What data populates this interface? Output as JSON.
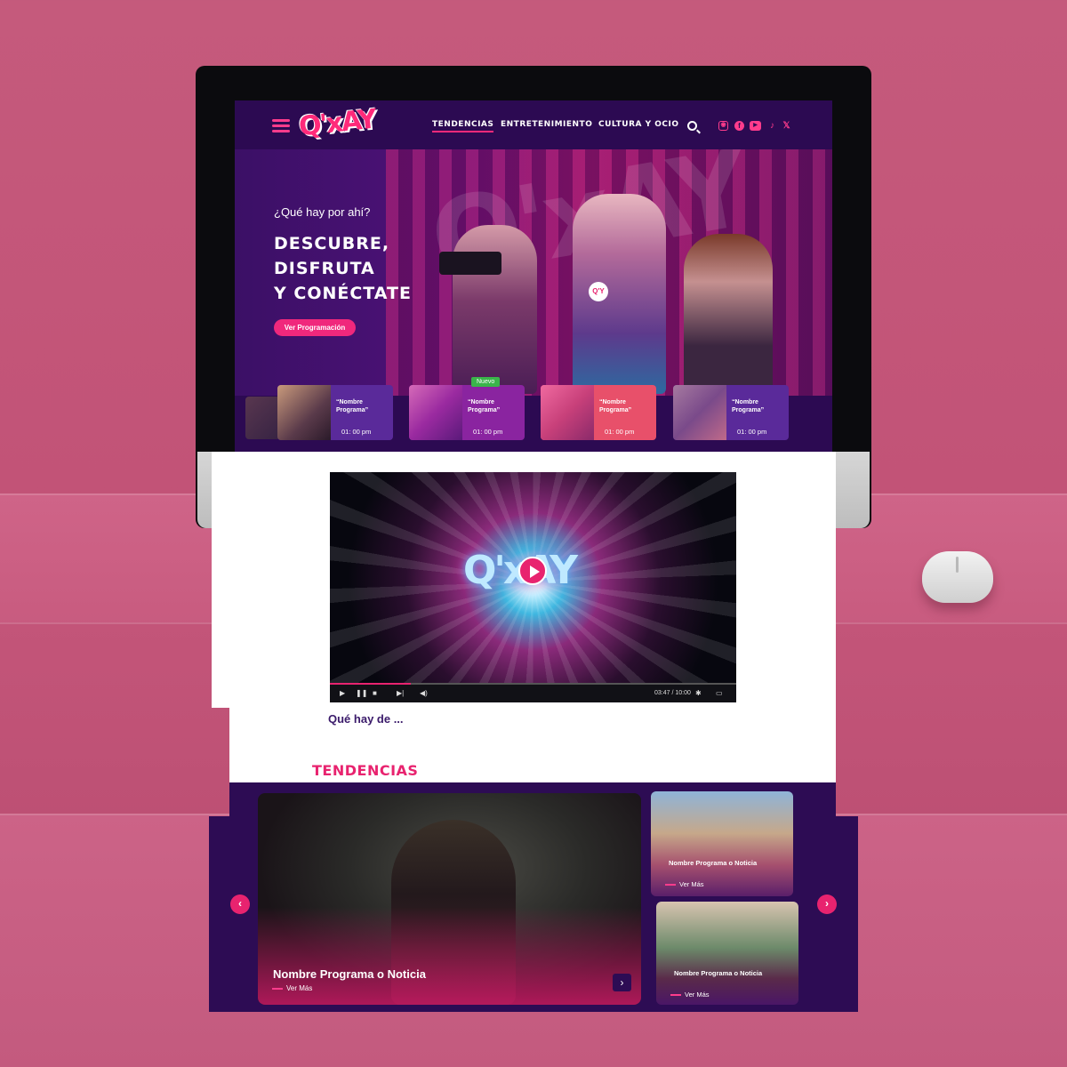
{
  "nav": {
    "links": [
      "TENDENCIAS",
      "ENTRETENIMIENTO",
      "CULTURA Y OCIO"
    ],
    "active": "TENDENCIAS",
    "logo": "Q'xAY",
    "social_icons": [
      "instagram-icon",
      "facebook-icon",
      "youtube-icon",
      "tiktok-icon",
      "x-icon"
    ]
  },
  "hero": {
    "eyebrow": "¿Qué hay por ahí?",
    "title_line1": "DESCUBRE,",
    "title_line2": "DISFRUTA",
    "title_line3": "Y CONÉCTATE",
    "cta": "Ver Programación",
    "mic_logo": "Q'Y"
  },
  "programs": [
    {
      "title": "“Nombre Programa”",
      "time": "01: 00 pm",
      "badge": ""
    },
    {
      "title": "“Nombre Programa”",
      "time": "01: 00 pm",
      "badge": "Nuevo"
    },
    {
      "title": "“Nombre Programa”",
      "time": "01: 00 pm",
      "badge": ""
    },
    {
      "title": "“Nombre Programa”",
      "time": "01: 00 pm",
      "badge": ""
    }
  ],
  "video": {
    "logo": "Q'xAY",
    "time": "03:47 / 10:00",
    "progress": 0.2
  },
  "section": {
    "que_hay": "Qué hay de ...",
    "tendencias": "TENDENCIAS"
  },
  "trends": {
    "main": {
      "title": "Nombre Programa o Noticia",
      "more": "Ver Más"
    },
    "side": [
      {
        "title": "Nombre Programa o Noticia",
        "more": "Ver Más"
      },
      {
        "title": "Nombre Programa o Noticia",
        "more": "Ver Más"
      }
    ]
  },
  "colors": {
    "accent": "#e8236f",
    "purple": "#2d0c54",
    "badge_green": "#3ab54a"
  }
}
